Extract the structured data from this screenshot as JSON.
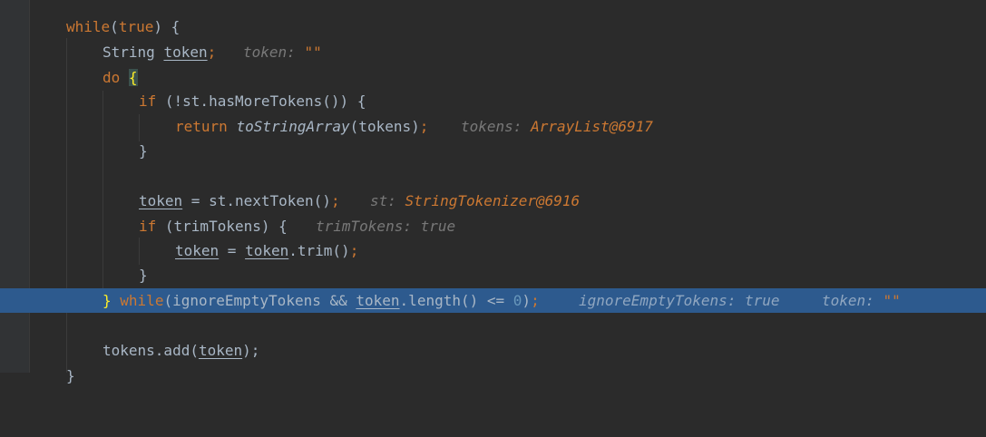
{
  "code": {
    "while_kw": "while",
    "true_kw": "true",
    "open_paren": "(",
    "close_paren_brace": ") {",
    "type_string": "String",
    "token_var": "token",
    "semicolon": ";",
    "do_kw": "do",
    "open_brace": "{",
    "if_kw": "if",
    "cond_has_more": " (!st.hasMoreTokens()) {",
    "return_kw": "return",
    "to_string_array": "toStringArray",
    "tokens_arg": "(tokens)",
    "close_brace": "}",
    "assign": " = ",
    "next_token_call": "st.nextToken()",
    "trim_cond": " (trimTokens) {",
    "trim_call": ".trim()",
    "while_cond_start": "(ignoreEmptyTokens && ",
    "length_call": ".length() <= ",
    "zero": "0",
    "close_paren": ")",
    "tokens_add": "tokens.add(",
    "close_paren_semicolon": ");"
  },
  "hints": {
    "token_label": "token: ",
    "token_value": "\"\"",
    "tokens_label": "tokens: ",
    "tokens_value": "ArrayList@6917",
    "st_label": "st: ",
    "st_value": "StringTokenizer@6916",
    "trim_tokens": "trimTokens: true",
    "ignore_empty": "ignoreEmptyTokens: true",
    "token_label2": "token: ",
    "token_value2": "\"\""
  },
  "colors": {
    "background": "#2b2b2b",
    "keyword": "#cc7832",
    "number": "#6897bb",
    "text": "#a9b7c6",
    "hint": "#787878",
    "execution_line": "#2d5a8e",
    "brace_match": "#ffef28"
  }
}
